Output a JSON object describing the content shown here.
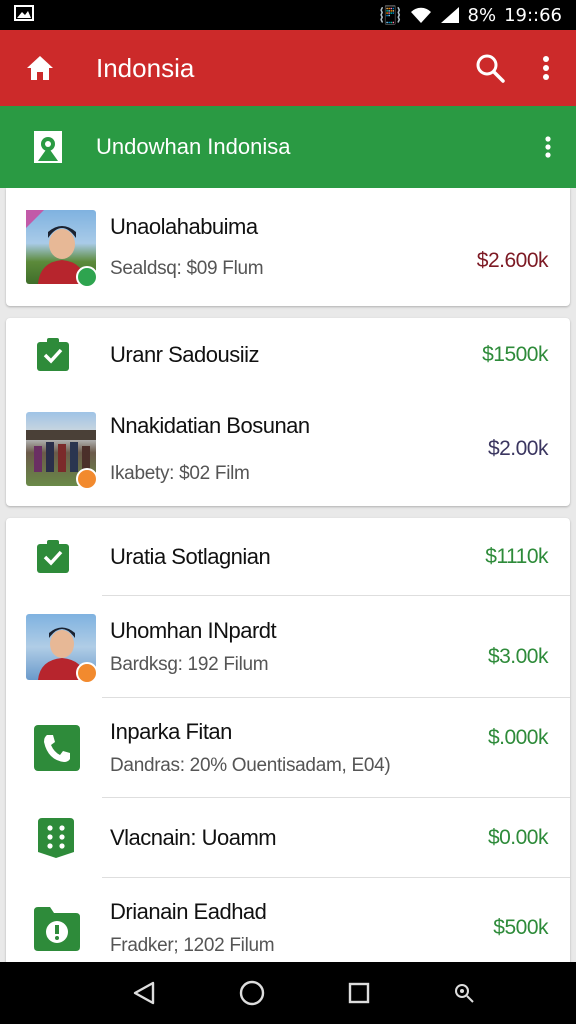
{
  "status_bar": {
    "battery": "8%",
    "time": "19::66"
  },
  "app_bar": {
    "title": "Indonsia"
  },
  "sub_bar": {
    "title": "Undowhan Indonisa"
  },
  "colors": {
    "app_bar": "#cc2a2a",
    "sub_bar": "#2a9a43",
    "amount_green": "#2e8b3a",
    "amount_maroon": "#7d1a24",
    "amount_navy": "#3b3660",
    "badge_green": "#2ea44f",
    "badge_orange": "#f28a2e"
  },
  "card1": {
    "items": [
      {
        "title": "Unaolahabuima",
        "subtitle": "Sealdsq:  $09 Flum",
        "amount": "$2.600k",
        "thumb": "person-photo",
        "badge": "green"
      }
    ]
  },
  "card2": {
    "items": [
      {
        "title": "Uranr Sadousiiz",
        "amount": "$1500k",
        "icon": "checklist-icon"
      },
      {
        "title": "Nnakidatian Bosunan",
        "subtitle": "Ikabety: $02 Film",
        "amount": "$2.00k",
        "thumb": "group-photo",
        "badge": "orange"
      }
    ]
  },
  "card3": {
    "items": [
      {
        "title": "Uratia Sotlagnian",
        "amount": "$1110k",
        "icon": "checklist-icon"
      },
      {
        "title": "Uhomhan INpardt",
        "subtitle": "Bardksg: 192 Filum",
        "amount": "$3.00k",
        "thumb": "person-photo",
        "badge": "orange"
      },
      {
        "title": "Inparka Fitan",
        "subtitle": "Dandras: 20% Ouentisadam, E04)",
        "amount": "$.000k",
        "icon": "phone-icon"
      },
      {
        "title": "Vlacnain: Uoamm",
        "amount": "$0.00k",
        "icon": "dots-grid-icon"
      },
      {
        "title": "Drianain Eadhad",
        "subtitle": "Fradker; 1202 Filum",
        "amount": "$500k",
        "icon": "alert-folder-icon"
      }
    ]
  }
}
